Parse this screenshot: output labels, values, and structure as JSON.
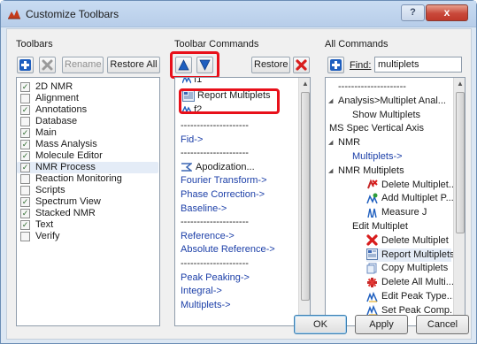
{
  "window": {
    "title": "Customize Toolbars",
    "help_label": "?",
    "close_label": "x"
  },
  "toolbars": {
    "heading": "Toolbars",
    "rename_label": "Rename",
    "restore_all_label": "Restore All",
    "items": [
      {
        "label": "2D NMR",
        "checked": true
      },
      {
        "label": "Alignment",
        "checked": false
      },
      {
        "label": "Annotations",
        "checked": true
      },
      {
        "label": "Database",
        "checked": false
      },
      {
        "label": "Main",
        "checked": true
      },
      {
        "label": "Mass Analysis",
        "checked": true
      },
      {
        "label": "Molecule Editor",
        "checked": true
      },
      {
        "label": "NMR Process",
        "checked": true,
        "selected": true
      },
      {
        "label": "Reaction Monitoring",
        "checked": false
      },
      {
        "label": "Scripts",
        "checked": false
      },
      {
        "label": "Spectrum View",
        "checked": true
      },
      {
        "label": "Stacked NMR",
        "checked": true
      },
      {
        "label": "Text",
        "checked": true
      },
      {
        "label": "Verify",
        "checked": false
      }
    ]
  },
  "toolbar_commands": {
    "heading": "Toolbar Commands",
    "restore_label": "Restore",
    "partial_top": "f1",
    "highlighted_item": "Report Multiplets",
    "partial_f2": "f2",
    "items": [
      {
        "label": "---------------------",
        "style": "dash"
      },
      {
        "label": "Fid->",
        "style": "blue"
      },
      {
        "label": "---------------------",
        "style": "dash"
      },
      {
        "label": "Apodization...",
        "style": "icon"
      },
      {
        "label": "Fourier Transform->",
        "style": "blue"
      },
      {
        "label": "Phase Correction->",
        "style": "blue"
      },
      {
        "label": "Baseline->",
        "style": "blue"
      },
      {
        "label": "---------------------",
        "style": "dash"
      },
      {
        "label": "Reference->",
        "style": "blue"
      },
      {
        "label": "Absolute Reference->",
        "style": "blue"
      },
      {
        "label": "---------------------",
        "style": "dash"
      },
      {
        "label": "Peak Peaking->",
        "style": "blue"
      },
      {
        "label": "Integral->",
        "style": "blue"
      },
      {
        "label": "Multiplets->",
        "style": "blue"
      }
    ]
  },
  "all_commands": {
    "heading": "All Commands",
    "find_label": "Find:",
    "find_value": "multiplets",
    "items": [
      {
        "label": "---------------------",
        "indent": 0,
        "arrow": false
      },
      {
        "label": "Analysis>Multiplet Anal...",
        "indent": 0,
        "arrow": true
      },
      {
        "label": "Show Multiplets",
        "indent": 1,
        "arrow": false
      },
      {
        "label": "MS Spec Vertical Axis",
        "indent": 0,
        "arrow": false,
        "flush": true
      },
      {
        "label": "NMR",
        "indent": 0,
        "arrow": true
      },
      {
        "label": "Multiplets->",
        "indent": 1,
        "arrow": false,
        "blue": true
      },
      {
        "label": "NMR Multiplets",
        "indent": 0,
        "arrow": true
      },
      {
        "label": "Delete Multiplet...",
        "indent": 2,
        "icon": "delete-multiplet"
      },
      {
        "label": "Add Multiplet P...",
        "indent": 2,
        "icon": "add-multiplet"
      },
      {
        "label": "Measure J",
        "indent": 2,
        "icon": "measure-j"
      },
      {
        "label": "Edit Multiplet",
        "indent": 1,
        "arrow": false
      },
      {
        "label": "Delete Multiplet",
        "indent": 2,
        "icon": "red-x"
      },
      {
        "label": "Report Multiplets",
        "indent": 2,
        "icon": "report",
        "selected": true
      },
      {
        "label": "Copy Multiplets",
        "indent": 2,
        "icon": "copy"
      },
      {
        "label": "Delete All Multi...",
        "indent": 2,
        "icon": "red-cross"
      },
      {
        "label": "Edit Peak Type...",
        "indent": 2,
        "icon": "peak"
      },
      {
        "label": "Set Peak Comp...",
        "indent": 2,
        "icon": "peak"
      }
    ]
  },
  "footer": {
    "ok_label": "OK",
    "apply_label": "Apply",
    "cancel_label": "Cancel"
  },
  "colors": {
    "highlight": "#e8101a",
    "link_blue": "#1c3fa8",
    "accent_blue": "#1f5fbf"
  }
}
